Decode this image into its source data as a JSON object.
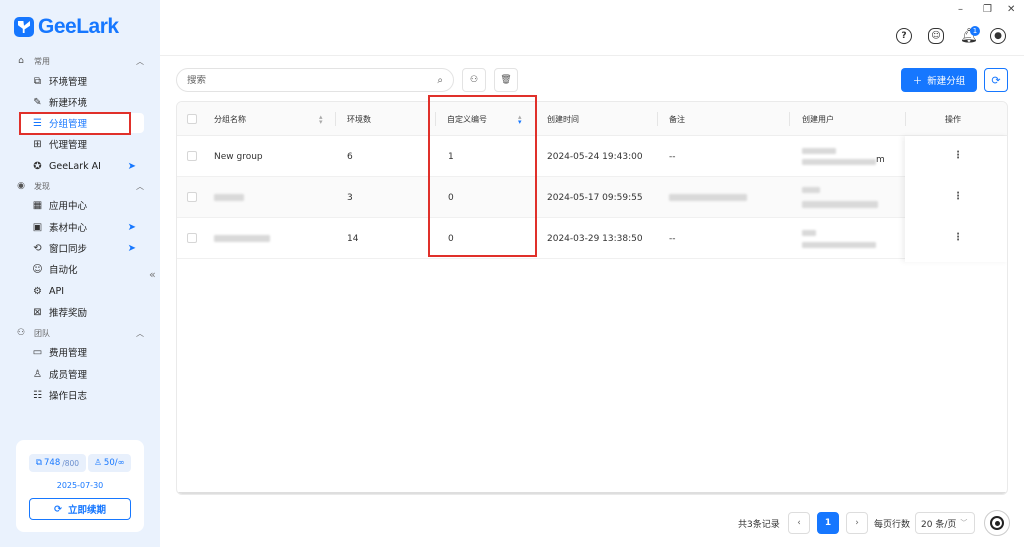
{
  "app": {
    "name": "GeeLark"
  },
  "sidebar": {
    "sections": [
      {
        "label": "常用",
        "icon": "home-icon"
      },
      {
        "label": "发现",
        "icon": "eye-icon"
      },
      {
        "label": "团队",
        "icon": "team-icon"
      }
    ],
    "items": [
      {
        "label": "环境管理",
        "icon": "env-icon"
      },
      {
        "label": "新建环境",
        "icon": "edit-icon"
      },
      {
        "label": "分组管理",
        "icon": "list-icon",
        "active": true
      },
      {
        "label": "代理管理",
        "icon": "proxy-icon"
      },
      {
        "label": "GeeLark AI",
        "icon": "ai-icon",
        "badge": true
      },
      {
        "label": "应用中心",
        "icon": "apps-icon"
      },
      {
        "label": "素材中心",
        "icon": "material-icon",
        "badge": true
      },
      {
        "label": "窗口同步",
        "icon": "sync-icon",
        "badge": true
      },
      {
        "label": "自动化",
        "icon": "robot-icon"
      },
      {
        "label": "API",
        "icon": "api-icon"
      },
      {
        "label": "推荐奖励",
        "icon": "gift-icon"
      },
      {
        "label": "费用管理",
        "icon": "wallet-icon"
      },
      {
        "label": "成员管理",
        "icon": "user-icon"
      },
      {
        "label": "操作日志",
        "icon": "log-icon"
      }
    ],
    "quota": {
      "env_used": "748",
      "env_total": "/800",
      "members": "50/∞",
      "expire_date": "2025-07-30",
      "renew_label": "立即续期"
    },
    "collapse_glyph": "«"
  },
  "topbar": {
    "window_controls": [
      "–",
      "❐",
      "✕"
    ],
    "notification_count": "1"
  },
  "toolbar": {
    "search_placeholder": "搜索",
    "new_group_label": "新建分组"
  },
  "table": {
    "columns": [
      "分组名称",
      "环境数",
      "自定义编号",
      "创建时间",
      "备注",
      "创建用户",
      "操作"
    ],
    "rows": [
      {
        "name": "New group",
        "env_count": "6",
        "custom_no": "1",
        "created": "2024-05-24 19:43:00",
        "remark": "--",
        "creator_suffix": "m"
      },
      {
        "name": "",
        "env_count": "3",
        "custom_no": "0",
        "created": "2024-05-17 09:59:55",
        "remark": "",
        "creator_suffix": ""
      },
      {
        "name": "",
        "env_count": "14",
        "custom_no": "0",
        "created": "2024-03-29 13:38:50",
        "remark": "--",
        "creator_suffix": ""
      }
    ],
    "row_action_glyph": "⋮"
  },
  "pagination": {
    "total_label": "共3条记录",
    "current_page": "1",
    "rows_per_page_label": "每页行数",
    "page_size": "20 条/页"
  }
}
